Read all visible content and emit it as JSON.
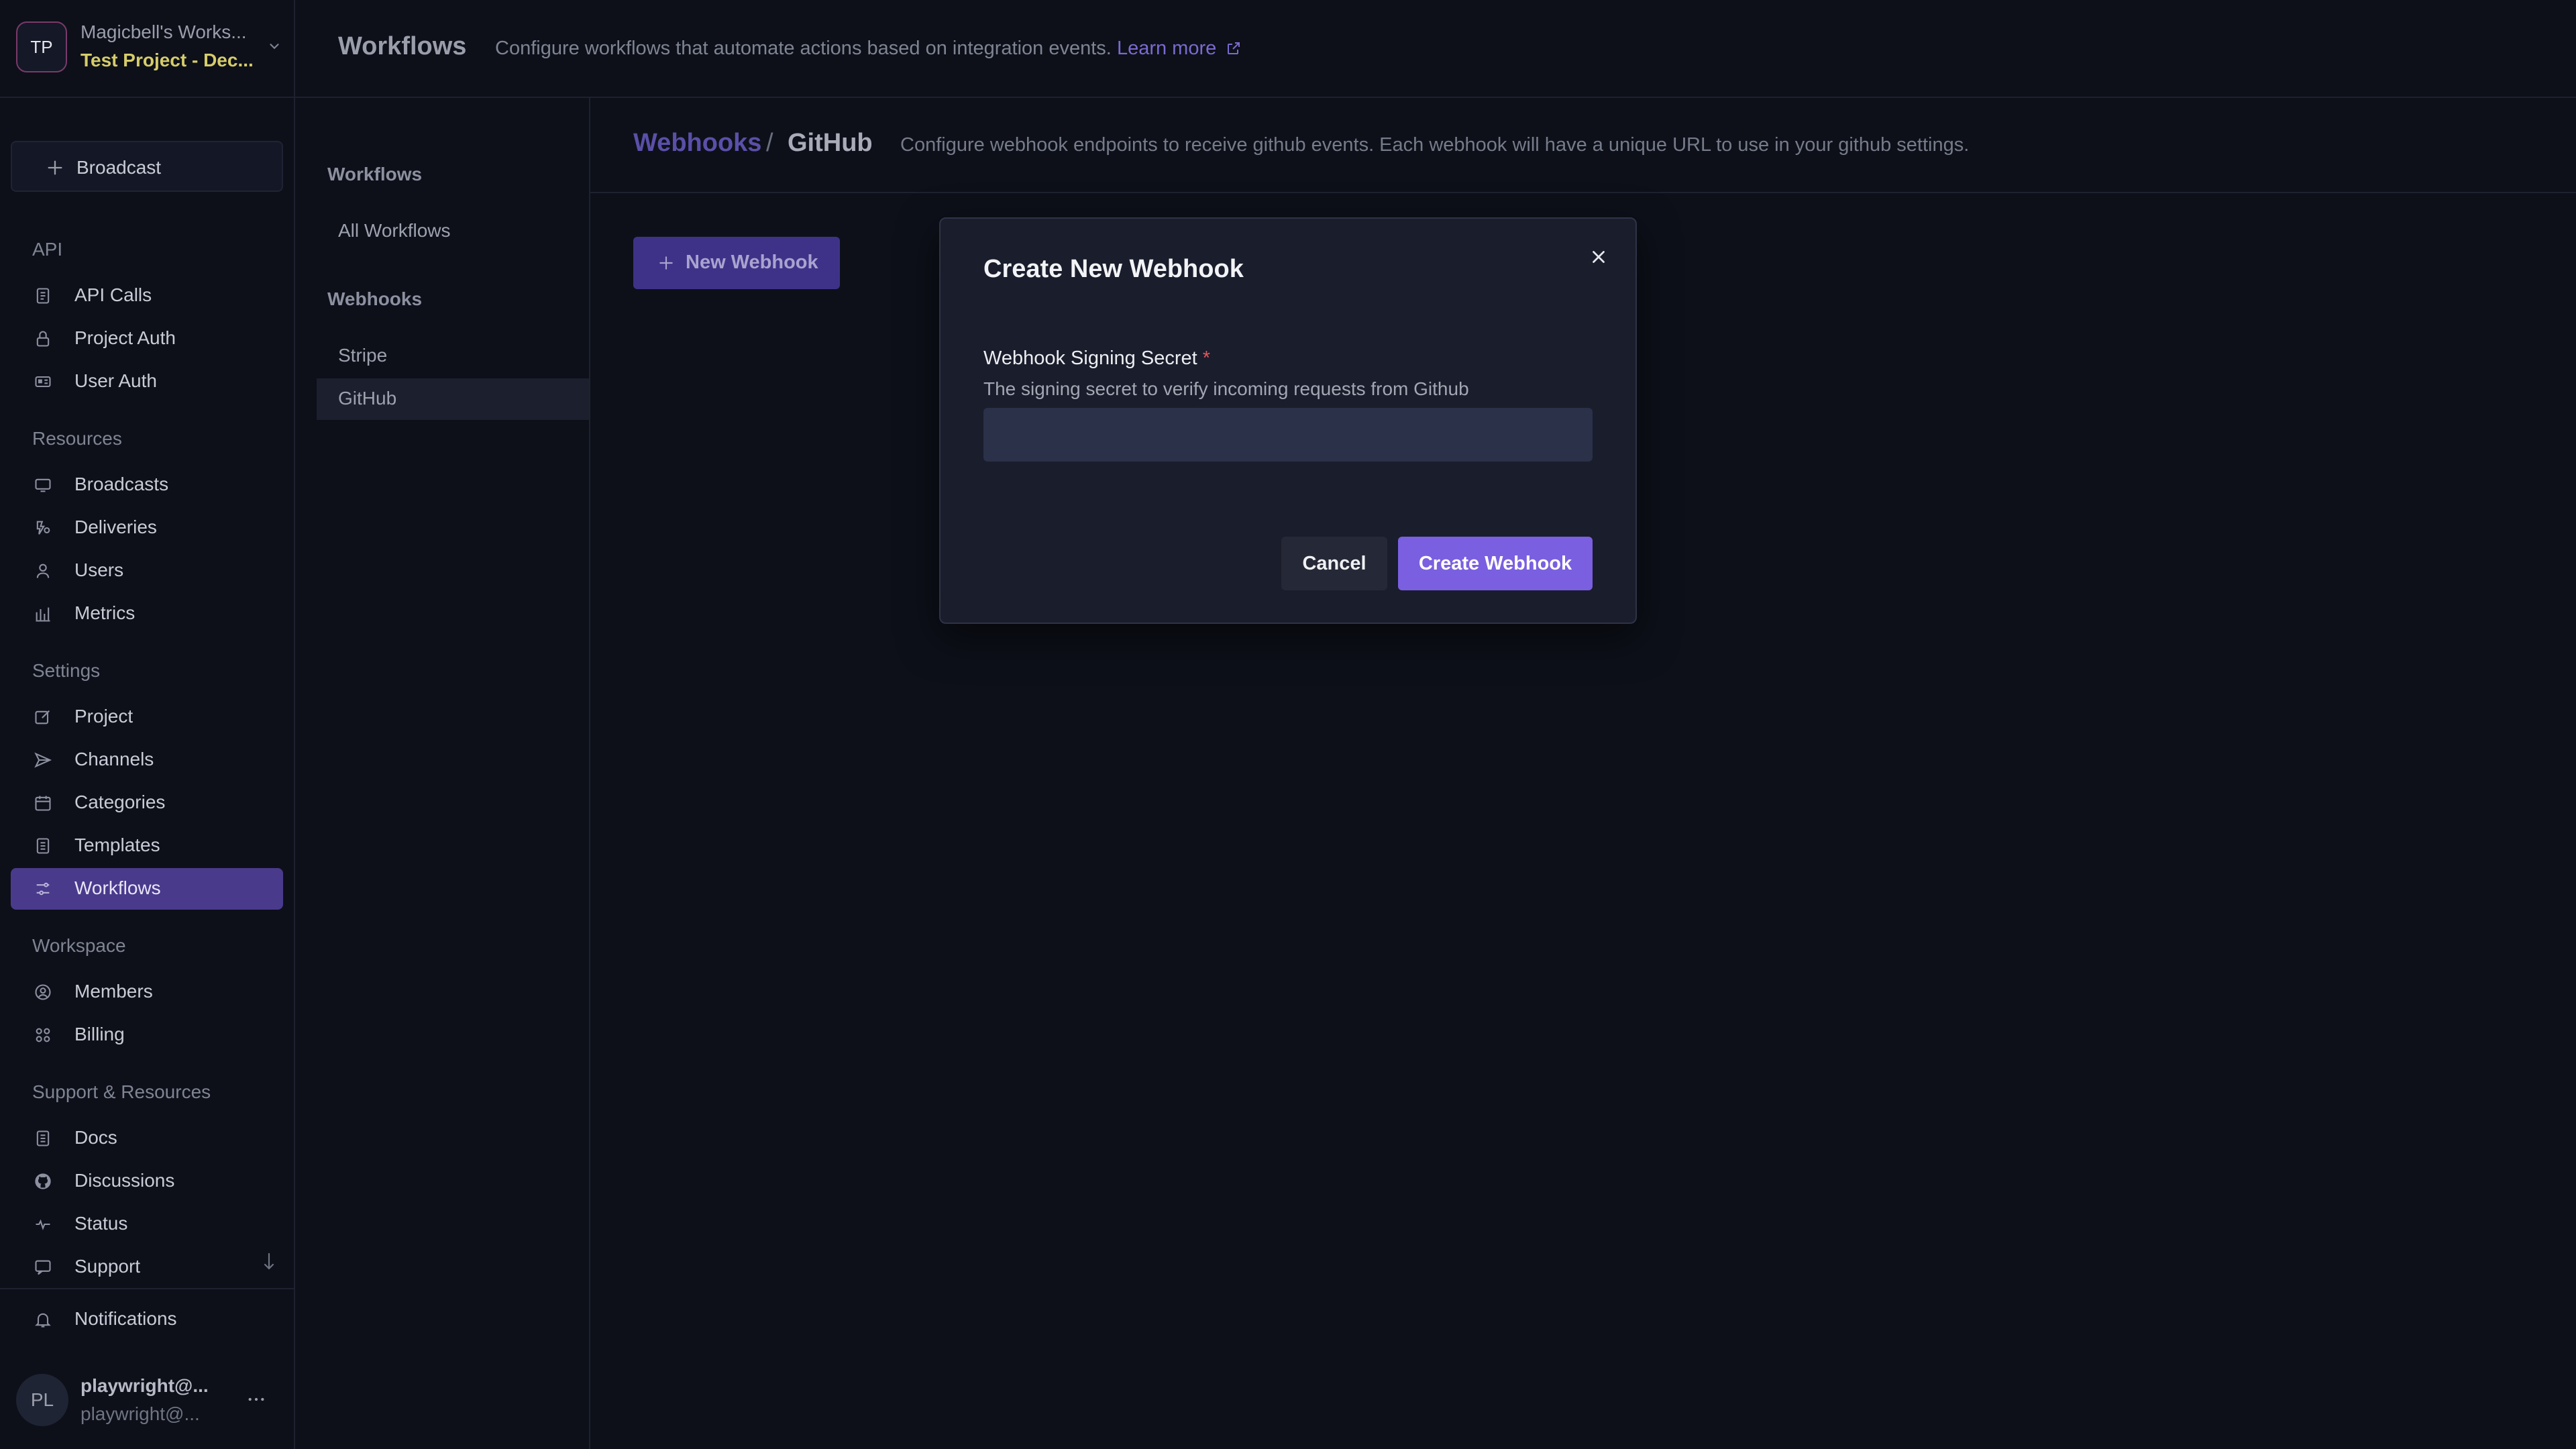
{
  "workspace": {
    "avatar_initials": "TP",
    "name": "Magicbell's Works...",
    "project": "Test Project - Dec..."
  },
  "sidebar": {
    "broadcast_label": "Broadcast",
    "sections": [
      {
        "title": "API",
        "items": [
          {
            "label": "API Calls",
            "icon": "list-icon"
          },
          {
            "label": "Project Auth",
            "icon": "lock-icon"
          },
          {
            "label": "User Auth",
            "icon": "id-card-icon"
          }
        ]
      },
      {
        "title": "Resources",
        "items": [
          {
            "label": "Broadcasts",
            "icon": "monitor-icon"
          },
          {
            "label": "Deliveries",
            "icon": "deliveries-icon"
          },
          {
            "label": "Users",
            "icon": "user-icon"
          },
          {
            "label": "Metrics",
            "icon": "bar-chart-icon"
          }
        ]
      },
      {
        "title": "Settings",
        "items": [
          {
            "label": "Project",
            "icon": "edit-icon"
          },
          {
            "label": "Channels",
            "icon": "send-icon"
          },
          {
            "label": "Categories",
            "icon": "calendar-icon"
          },
          {
            "label": "Templates",
            "icon": "document-icon"
          },
          {
            "label": "Workflows",
            "icon": "sliders-icon",
            "active": true
          }
        ]
      },
      {
        "title": "Workspace",
        "items": [
          {
            "label": "Members",
            "icon": "user-circle-icon"
          },
          {
            "label": "Billing",
            "icon": "grid-icon"
          }
        ]
      },
      {
        "title": "Support & Resources",
        "items": [
          {
            "label": "Docs",
            "icon": "document-icon"
          },
          {
            "label": "Discussions",
            "icon": "github-icon"
          },
          {
            "label": "Status",
            "icon": "pulse-icon"
          },
          {
            "label": "Support",
            "icon": "chat-icon"
          }
        ]
      }
    ],
    "notifications_label": "Notifications"
  },
  "user": {
    "avatar_initials": "PL",
    "name": "playwright@...",
    "email": "playwright@..."
  },
  "header": {
    "title": "Workflows",
    "description": "Configure workflows that automate actions based on integration events.",
    "learn_more": "Learn more"
  },
  "subnav": {
    "workflows_title": "Workflows",
    "all_workflows": "All Workflows",
    "webhooks_title": "Webhooks",
    "stripe": "Stripe",
    "github": "GitHub"
  },
  "content": {
    "breadcrumb_parent": "Webhooks",
    "breadcrumb_separator": "/",
    "breadcrumb_current": "GitHub",
    "description": "Configure webhook endpoints to receive github events. Each webhook will have a unique URL to use in your github settings.",
    "new_webhook_label": "New Webhook"
  },
  "modal": {
    "title": "Create New Webhook",
    "field_label": "Webhook Signing Secret",
    "required_marker": "*",
    "field_help": "The signing secret to verify incoming requests from Github",
    "field_value": "",
    "cancel_label": "Cancel",
    "create_label": "Create Webhook"
  },
  "colors": {
    "background": "#0d1019",
    "accent": "#7a5fe0",
    "active_nav": "#4a3a8c",
    "project_name": "#d6cc6a"
  }
}
